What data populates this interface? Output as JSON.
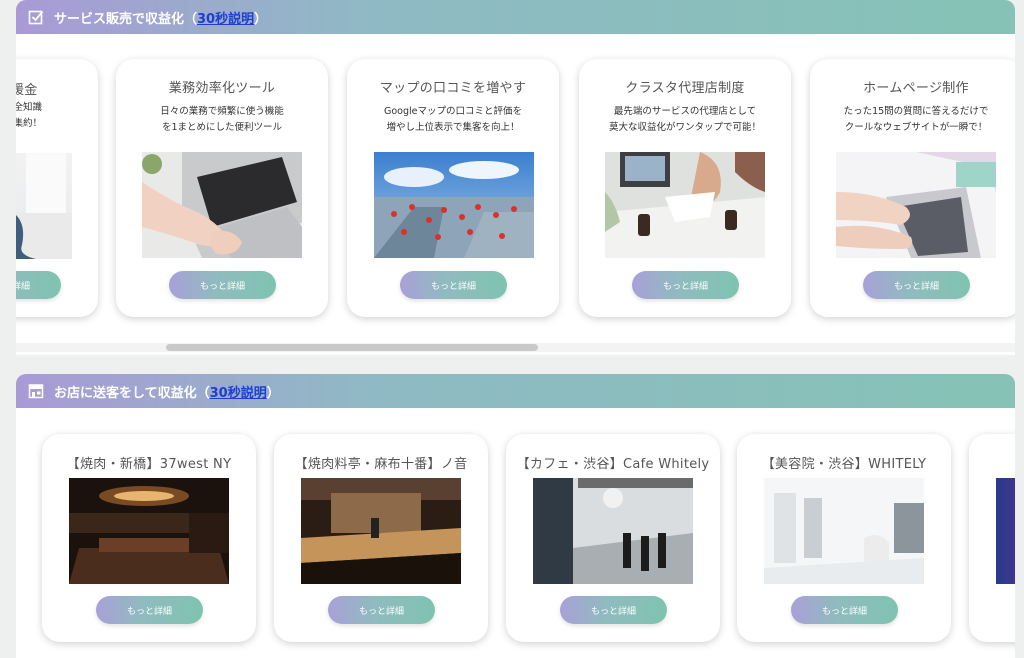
{
  "section1": {
    "title": "サービス販売で収益化（",
    "link": "30秒説明",
    "close": "）",
    "icon": "checkbox-icon",
    "cards": [
      {
        "title": "援金",
        "desc1": "の全知識",
        "desc2": "に集約！",
        "button": "もっと詳細"
      },
      {
        "title": "業務効率化ツール",
        "desc1": "日々の業務で頻繁に使う機能",
        "desc2": "を1まとめにした便利ツール",
        "button": "もっと詳細"
      },
      {
        "title": "マップの口コミを増やす",
        "desc1": "Googleマップの口コミと評価を",
        "desc2": "増やし上位表示で集客を向上！",
        "button": "もっと詳細"
      },
      {
        "title": "クラスタ代理店制度",
        "desc1": "最先端のサービスの代理店として",
        "desc2": "莫大な収益化がワンタップで可能！",
        "button": "もっと詳細"
      },
      {
        "title": "ホームページ制作",
        "desc1": "たった15問の質問に答えるだけで",
        "desc2": "クールなウェブサイトが一瞬で！",
        "button": "もっと詳細"
      }
    ]
  },
  "section2": {
    "title": "お店に送客をして収益化（",
    "link": "30秒説明",
    "close": "）",
    "icon": "store-icon",
    "cards": [
      {
        "title": "【焼肉・新橋】37west NY",
        "button": "もっと詳細"
      },
      {
        "title": "【焼肉料亭・麻布十番】ノ音",
        "button": "もっと詳細"
      },
      {
        "title": "【カフェ・渋谷】Cafe Whitely",
        "button": "もっと詳細"
      },
      {
        "title": "【美容院・渋谷】WHITELY",
        "button": "もっと詳細"
      }
    ]
  }
}
